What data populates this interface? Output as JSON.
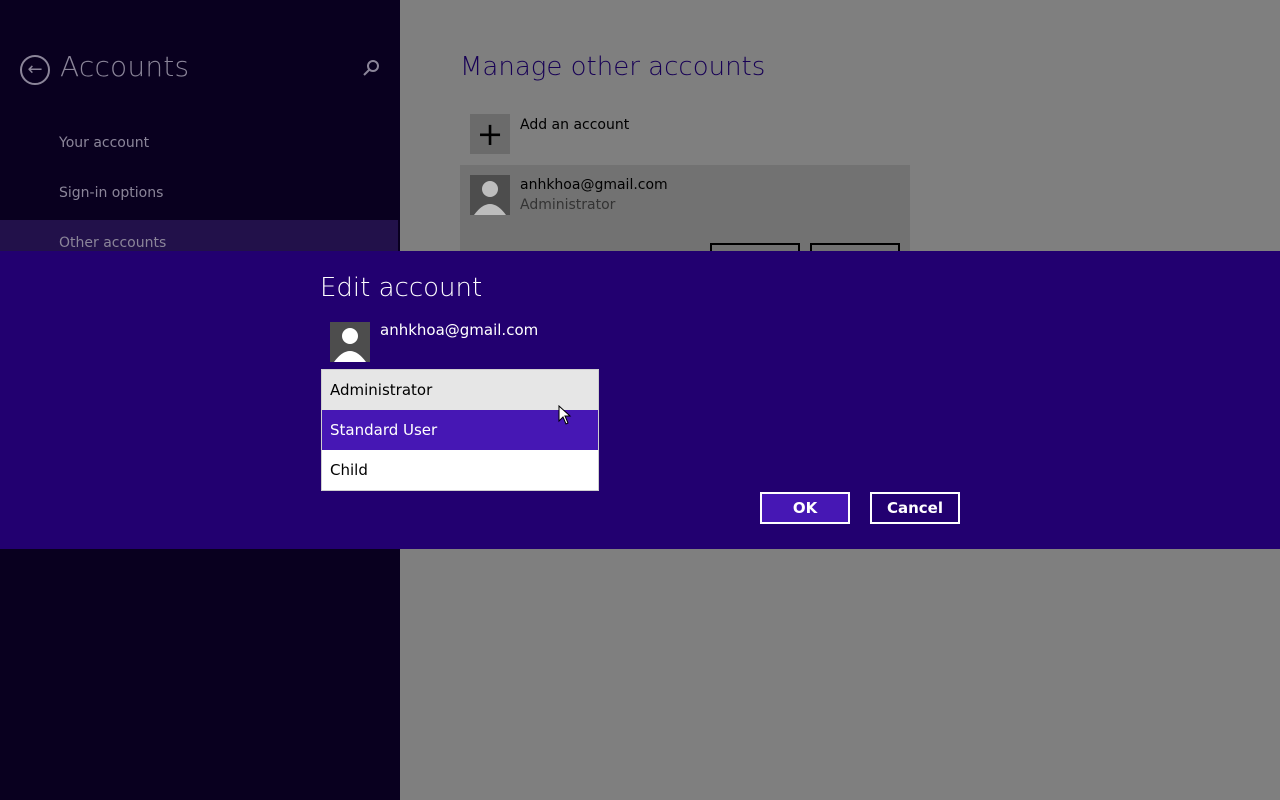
{
  "left_pane": {
    "title": "Accounts",
    "back_icon": "back-arrow-icon",
    "search_icon": "search-icon",
    "nav_items": [
      {
        "label": "Your account"
      },
      {
        "label": "Sign-in options"
      },
      {
        "label": "Other accounts",
        "selected": true
      }
    ]
  },
  "content": {
    "title": "Manage other accounts",
    "add_account_label": "Add an account",
    "add_icon": "plus-icon",
    "account": {
      "email": "anhkhoa@gmail.com",
      "role": "Administrator",
      "avatar_icon": "user-avatar-icon"
    }
  },
  "dialog": {
    "title": "Edit account",
    "email": "anhkhoa@gmail.com",
    "avatar_icon": "user-avatar-icon",
    "account_type_options": [
      "Administrator",
      "Standard User",
      "Child"
    ],
    "highlighted_option": "Standard User",
    "ok_label": "OK",
    "cancel_label": "Cancel"
  },
  "colors": {
    "dialog_bg": "#220070",
    "accent": "#4617b4",
    "left_pane_bg": "#09001f",
    "dim_overlay": "#7f7f7f"
  }
}
